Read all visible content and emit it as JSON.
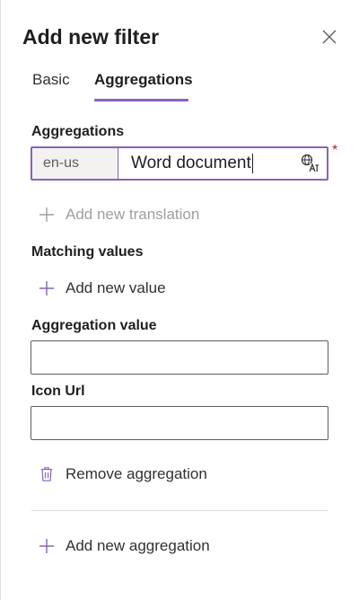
{
  "panel": {
    "title": "Add new filter",
    "close_icon": "close-icon"
  },
  "tabs": [
    {
      "label": "Basic",
      "active": false
    },
    {
      "label": "Aggregations",
      "active": true
    }
  ],
  "aggregations_section": {
    "label": "Aggregations",
    "locale": "en-us",
    "value": "Word document",
    "required_marker": "*",
    "translate_icon": "translate-icon",
    "add_translation_label": "Add new translation"
  },
  "matching_values": {
    "label": "Matching values",
    "add_value_label": "Add new value"
  },
  "aggregation_value": {
    "label": "Aggregation value",
    "value": ""
  },
  "icon_url": {
    "label": "Icon Url",
    "value": ""
  },
  "remove_aggregation_label": "Remove aggregation",
  "add_aggregation_label": "Add new aggregation",
  "colors": {
    "accent": "#8764b8",
    "required": "#a4262c",
    "text": "#323130",
    "disabled": "#a19f9d"
  }
}
